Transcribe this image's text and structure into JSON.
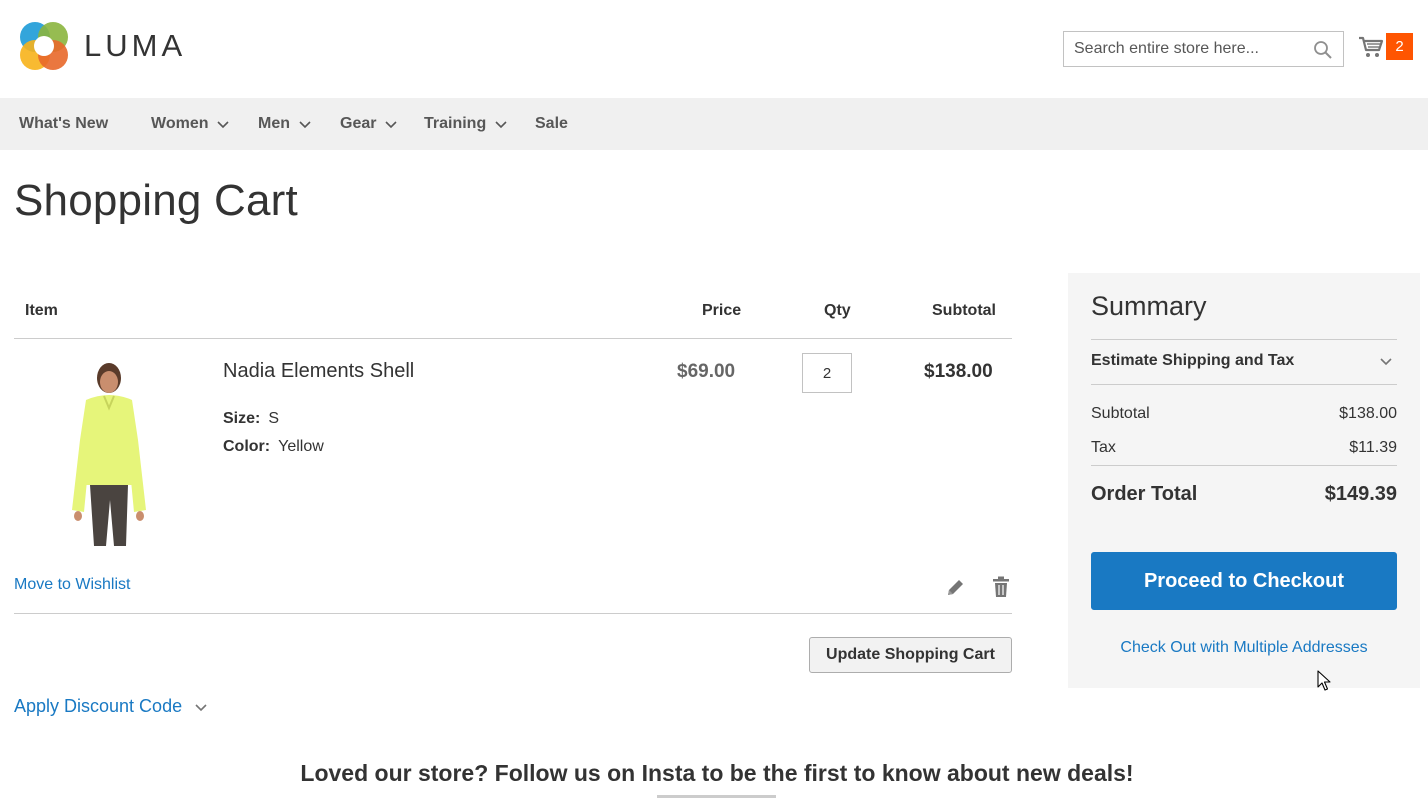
{
  "brand": {
    "name": "LUMA"
  },
  "search": {
    "placeholder": "Search entire store here..."
  },
  "minicart": {
    "count": "2",
    "badge_color": "#ff5501"
  },
  "nav": [
    {
      "label": "What's New",
      "dropdown": false
    },
    {
      "label": "Women",
      "dropdown": true
    },
    {
      "label": "Men",
      "dropdown": true
    },
    {
      "label": "Gear",
      "dropdown": true
    },
    {
      "label": "Training",
      "dropdown": true
    },
    {
      "label": "Sale",
      "dropdown": false
    }
  ],
  "page": {
    "title": "Shopping Cart"
  },
  "cart": {
    "headers": {
      "item": "Item",
      "price": "Price",
      "qty": "Qty",
      "subtotal": "Subtotal"
    },
    "items": [
      {
        "name": "Nadia Elements Shell",
        "options": [
          {
            "label": "Size:",
            "value": "S"
          },
          {
            "label": "Color:",
            "value": "Yellow"
          }
        ],
        "price": "$69.00",
        "qty": "2",
        "subtotal": "$138.00",
        "move_to_wishlist": "Move to Wishlist"
      }
    ],
    "update_button": "Update Shopping Cart",
    "discount_label": "Apply Discount Code"
  },
  "summary": {
    "title": "Summary",
    "shipping_label": "Estimate Shipping and Tax",
    "subtotal_label": "Subtotal",
    "subtotal_value": "$138.00",
    "tax_label": "Tax",
    "tax_value": "$11.39",
    "order_total_label": "Order Total",
    "order_total_value": "$149.39",
    "checkout_button": "Proceed to Checkout",
    "multi_address_link": "Check Out with Multiple Addresses"
  },
  "footer": {
    "promo": "Loved our store? Follow us on Insta to be the first to know about new deals!"
  },
  "colors": {
    "accent": "#1979c3",
    "nav_bg": "#f0f0f0",
    "summary_bg": "#f5f5f5"
  }
}
